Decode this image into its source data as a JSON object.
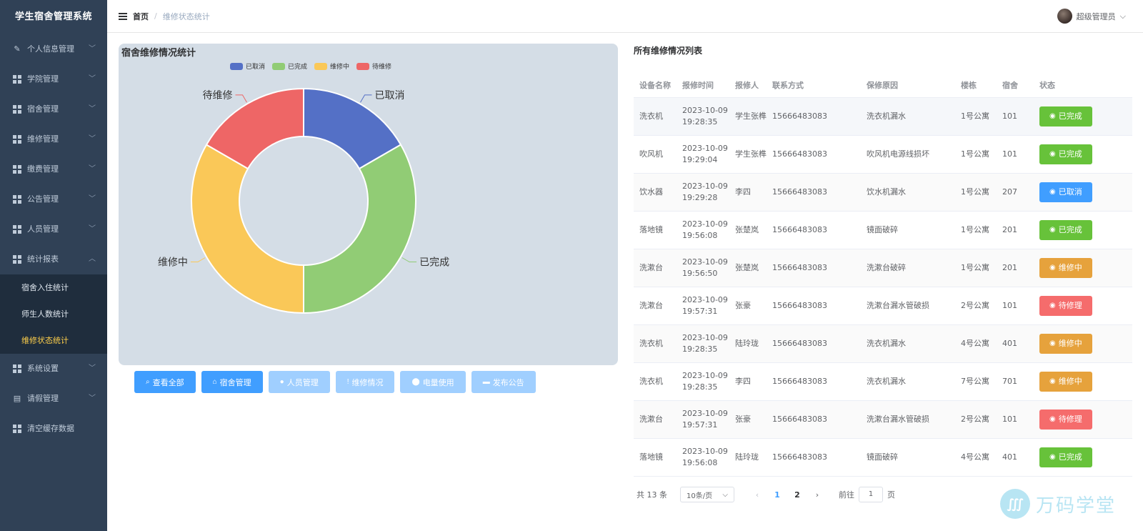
{
  "app": {
    "title": "学生宿舍管理系统"
  },
  "sidebar": {
    "items": [
      {
        "label": "个人信息管理",
        "icon": "edit-icon"
      },
      {
        "label": "学院管理",
        "icon": "grid-icon"
      },
      {
        "label": "宿舍管理",
        "icon": "grid-icon"
      },
      {
        "label": "维修管理",
        "icon": "grid-icon"
      },
      {
        "label": "缴费管理",
        "icon": "grid-icon"
      },
      {
        "label": "公告管理",
        "icon": "grid-icon"
      },
      {
        "label": "人员管理",
        "icon": "grid-icon"
      },
      {
        "label": "统计报表",
        "icon": "grid-icon"
      }
    ],
    "sub_items": [
      {
        "label": "宿舍入住统计"
      },
      {
        "label": "师生人数统计"
      },
      {
        "label": "维修状态统计"
      }
    ],
    "items_after": [
      {
        "label": "系统设置",
        "icon": "grid-icon"
      },
      {
        "label": "请假管理",
        "icon": "document-icon"
      },
      {
        "label": "清空缓存数据",
        "icon": "grid-icon"
      }
    ]
  },
  "header": {
    "breadcrumb_home": "首页",
    "breadcrumb_sep": "/",
    "breadcrumb_current": "维修状态统计",
    "user_name": "超级管理员"
  },
  "chart_data": {
    "type": "pie",
    "title": "宿舍维修情况统计",
    "categories": [
      "已取消",
      "已完成",
      "维修中",
      "待维修"
    ],
    "values": [
      2,
      4,
      4,
      2
    ],
    "colors": [
      "#5470c6",
      "#91cc75",
      "#fac858",
      "#ee6666"
    ],
    "legend_position": "top",
    "donut": true
  },
  "actions": [
    {
      "label": "查看全部",
      "icon": "search-icon",
      "state": "primary"
    },
    {
      "label": "宿舍管理",
      "icon": "home-icon",
      "state": "primary"
    },
    {
      "label": "人员管理",
      "icon": "user-icon",
      "state": "disabled"
    },
    {
      "label": "维修情况",
      "icon": "info-icon",
      "state": "disabled"
    },
    {
      "label": "电量使用",
      "icon": "location-icon",
      "state": "disabled"
    },
    {
      "label": "发布公告",
      "icon": "message-icon",
      "state": "disabled"
    }
  ],
  "list": {
    "title": "所有维修情况列表",
    "columns": [
      "设备名称",
      "报修时间",
      "报修人",
      "联系方式",
      "保修原因",
      "楼栋",
      "宿舍",
      "状态"
    ],
    "rows": [
      {
        "device": "洗衣机",
        "time": "2023-10-09 19:28:35",
        "reporter": "学生张榫",
        "phone": "15666483083",
        "reason": "洗衣机漏水",
        "building": "1号公寓",
        "room": "101",
        "status": "已完成",
        "color": "#67c23a"
      },
      {
        "device": "吹风机",
        "time": "2023-10-09 19:29:04",
        "reporter": "学生张榫",
        "phone": "15666483083",
        "reason": "吹风机电源线损坏",
        "building": "1号公寓",
        "room": "101",
        "status": "已完成",
        "color": "#67c23a"
      },
      {
        "device": "饮水器",
        "time": "2023-10-09 19:29:28",
        "reporter": "李四",
        "phone": "15666483083",
        "reason": "饮水机漏水",
        "building": "1号公寓",
        "room": "207",
        "status": "已取消",
        "color": "#409eff"
      },
      {
        "device": "落地镜",
        "time": "2023-10-09 19:56:08",
        "reporter": "张楚岚",
        "phone": "15666483083",
        "reason": "镜面破碎",
        "building": "1号公寓",
        "room": "201",
        "status": "已完成",
        "color": "#67c23a"
      },
      {
        "device": "洗漱台",
        "time": "2023-10-09 19:56:50",
        "reporter": "张楚岚",
        "phone": "15666483083",
        "reason": "洗漱台破碎",
        "building": "1号公寓",
        "room": "201",
        "status": "维修中",
        "color": "#e6a23c"
      },
      {
        "device": "洗漱台",
        "time": "2023-10-09 19:57:31",
        "reporter": "张豪",
        "phone": "15666483083",
        "reason": "洗漱台漏水管破损",
        "building": "2号公寓",
        "room": "101",
        "status": "待修理",
        "color": "#f56c6c"
      },
      {
        "device": "洗衣机",
        "time": "2023-10-09 19:28:35",
        "reporter": "陆玲珑",
        "phone": "15666483083",
        "reason": "洗衣机漏水",
        "building": "4号公寓",
        "room": "401",
        "status": "维修中",
        "color": "#e6a23c"
      },
      {
        "device": "洗衣机",
        "time": "2023-10-09 19:28:35",
        "reporter": "李四",
        "phone": "15666483083",
        "reason": "洗衣机漏水",
        "building": "7号公寓",
        "room": "701",
        "status": "维修中",
        "color": "#e6a23c"
      },
      {
        "device": "洗漱台",
        "time": "2023-10-09 19:57:31",
        "reporter": "张豪",
        "phone": "15666483083",
        "reason": "洗漱台漏水管破损",
        "building": "2号公寓",
        "room": "101",
        "status": "待修理",
        "color": "#f56c6c"
      },
      {
        "device": "落地镜",
        "time": "2023-10-09 19:56:08",
        "reporter": "陆玲珑",
        "phone": "15666483083",
        "reason": "镜面破碎",
        "building": "4号公寓",
        "room": "401",
        "status": "已完成",
        "color": "#67c23a"
      }
    ]
  },
  "pagination": {
    "total": "共 13 条",
    "page_size": "10条/页",
    "pages": [
      "1",
      "2"
    ],
    "current": "1",
    "goto_prefix": "前往",
    "goto_value": "1",
    "goto_suffix": "页"
  },
  "watermark": {
    "text": "万码学堂"
  }
}
